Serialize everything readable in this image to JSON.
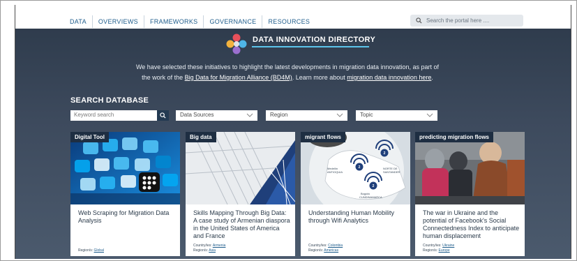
{
  "nav": {
    "items": [
      "DATA",
      "OVERVIEWS",
      "FRAMEWORKS",
      "GOVERNANCE",
      "RESOURCES"
    ],
    "search_placeholder": "Search the portal here ...."
  },
  "hero": {
    "title": "DATA INNOVATION DIRECTORY",
    "intro_line1": "We have selected these initiatives to highlight the latest developments in migration data innovation, as part of",
    "intro_line2_pre": "the work of the ",
    "intro_link1": "Big Data for Migration Alliance (BD4M)",
    "intro_line2_mid": ". Learn more about ",
    "intro_link2": "migration data innovation here",
    "intro_line2_end": "."
  },
  "search": {
    "title": "SEARCH DATABASE",
    "keyword_placeholder": "Keyword search",
    "filters": [
      "Data Sources",
      "Region",
      "Topic"
    ]
  },
  "colors": {
    "accent": "#5cc4ea",
    "nav_text": "#1f5d8c",
    "tag_bg": "#1e2e42",
    "hero_bg": "#3d4a5d"
  },
  "cards": [
    {
      "tag": "Digital Tool",
      "title": "Web Scraping for Migration Data Analysis",
      "country_label": "",
      "country": "",
      "region_label": "Region/s:",
      "region": "Global"
    },
    {
      "tag": "Big data",
      "title": "Skills Mapping Through Big Data: A case study of Armenian diaspora in the United States of America and France",
      "country_label": "Country/ies:",
      "country": "Armenia",
      "region_label": "Region/s:",
      "region": "Asia"
    },
    {
      "tag": "migrant flows",
      "title": "Understanding Human Mobility through Wifi Analytics",
      "country_label": "Country/ies:",
      "country": "Colombia",
      "region_label": "Region/s:",
      "region": "Americas",
      "map_labels": [
        "Medellín",
        "ANTIOQUIA",
        "NORTE DE",
        "SANTANDER",
        "Bogotá",
        "CUNDINAMARCA"
      ],
      "map_counts": [
        "2",
        "2",
        "2"
      ]
    },
    {
      "tag": "predicting migration flows",
      "title": "The war in Ukraine and the potential of Facebook's Social Connectedness Index to anticipate human displacement",
      "country_label": "Country/ies:",
      "country": "Ukraine",
      "region_label": "Region/s:",
      "region": "Europe"
    }
  ]
}
